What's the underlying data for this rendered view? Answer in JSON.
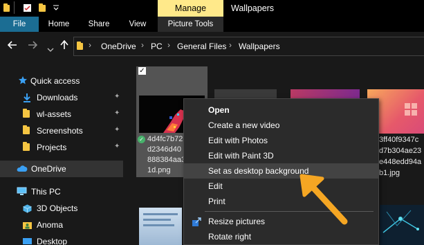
{
  "window": {
    "title": "Wallpapers",
    "contextual_tab_group": "Manage"
  },
  "ribbon": {
    "tabs": [
      {
        "label": "File"
      },
      {
        "label": "Home"
      },
      {
        "label": "Share"
      },
      {
        "label": "View"
      },
      {
        "label": "Picture Tools"
      }
    ]
  },
  "address": {
    "segments": [
      "OneDrive",
      "PC",
      "General Files",
      "Wallpapers"
    ]
  },
  "sidebar": {
    "items": [
      {
        "label": "Quick access",
        "icon": "star-icon"
      },
      {
        "label": "Downloads",
        "icon": "download-arrow-icon",
        "pinned": true
      },
      {
        "label": "wl-assets",
        "icon": "folder-icon",
        "pinned": true
      },
      {
        "label": "Screenshots",
        "icon": "folder-icon",
        "pinned": true
      },
      {
        "label": "Projects",
        "icon": "folder-icon",
        "pinned": true
      },
      {
        "label": "OneDrive",
        "icon": "cloud-icon",
        "selected": true
      },
      {
        "label": "This PC",
        "icon": "computer-icon"
      },
      {
        "label": "3D Objects",
        "icon": "cube-icon"
      },
      {
        "label": "Anoma",
        "icon": "user-folder-icon"
      },
      {
        "label": "Desktop",
        "icon": "desktop-icon"
      }
    ]
  },
  "files": {
    "selected": {
      "name_lines": [
        "4d4fc7b72",
        "d2346d40",
        "888384aa3",
        "1d.png"
      ],
      "checked": true,
      "sync_status": "synced"
    },
    "right_file": {
      "name_lines": [
        "3ff40f9347c",
        "d7b304ae23",
        "e448edd94a",
        "b1.jpg"
      ]
    }
  },
  "context_menu": {
    "items": [
      {
        "label": "Open",
        "bold": true
      },
      {
        "label": "Create a new video"
      },
      {
        "label": "Edit with Photos"
      },
      {
        "label": "Edit with Paint 3D"
      },
      {
        "label": "Set as desktop background",
        "highlighted": true
      },
      {
        "label": "Edit"
      },
      {
        "label": "Print"
      },
      {
        "label": "Resize pictures",
        "icon": "resize-icon"
      },
      {
        "label": "Rotate right"
      }
    ]
  },
  "colors": {
    "background": "#191919",
    "manage_tab": "#ffe98a",
    "file_tab": "#1b6d93",
    "menu_bg": "#2b2b2b",
    "highlight": "#434343",
    "annotation_arrow": "#f5a623",
    "folder": "#f5c542",
    "accent_blue": "#3aa0f3"
  }
}
